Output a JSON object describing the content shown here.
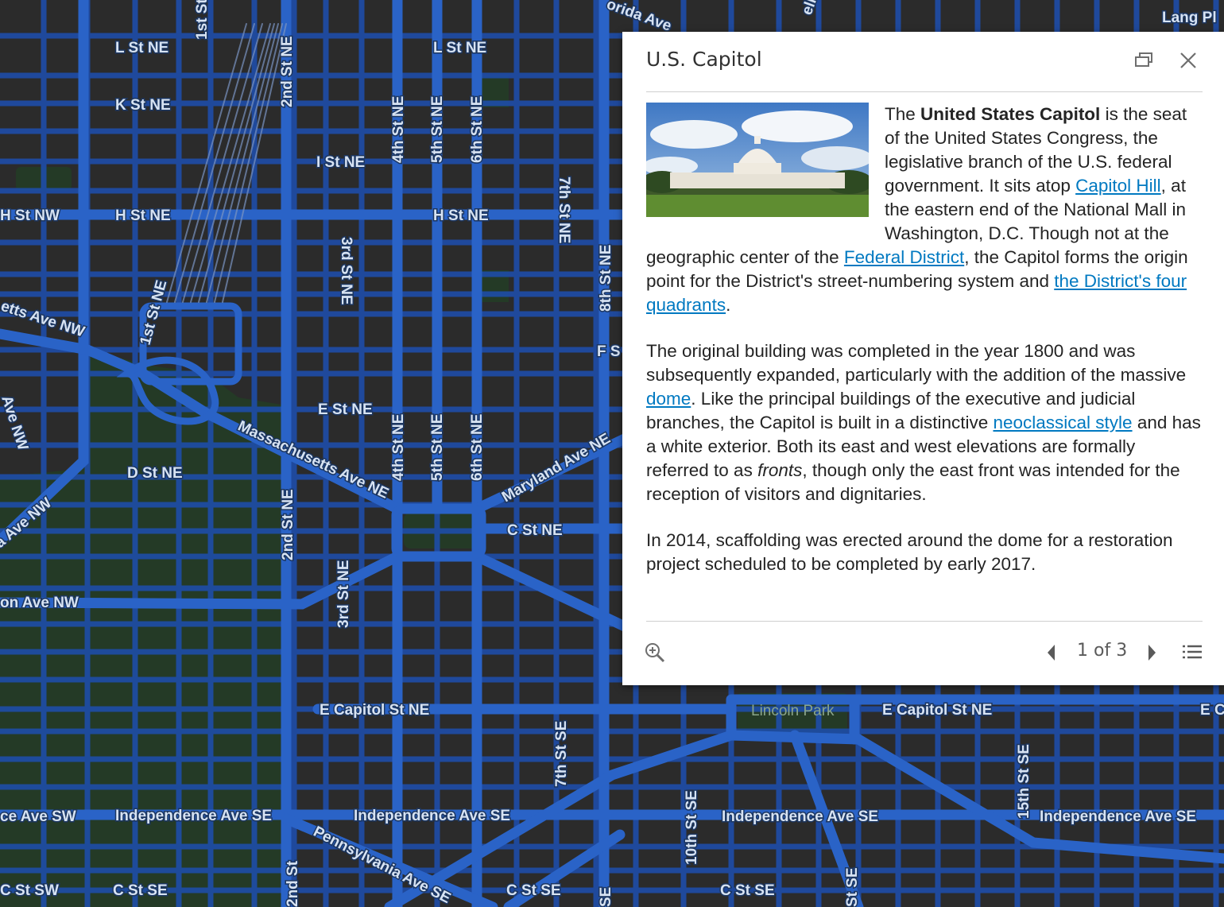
{
  "map": {
    "street_labels": {
      "l_st_1": "L St NE",
      "l_st_2": "L St NE",
      "k_st": "K St NE",
      "i_st": "I St NE",
      "h_st_nw": "H St NW",
      "h_st_1": "H St NE",
      "h_st_2": "H St NE",
      "e_st": "E St NE",
      "d_st": "D St NE",
      "c_st": "C St NE",
      "e_capitol_1": "E Capitol St NE",
      "e_capitol_2": "E Capitol St NE",
      "e_capitol_3": "E C",
      "independence_1": "Independence Ave SE",
      "independence_2": "Independence Ave SE",
      "independence_3": "Independence Ave SE",
      "independence_4": "Independence Ave SE",
      "independence_sw": "ce Ave SW",
      "c_st_sw": "C St SW",
      "c_st_se_1": "C St SE",
      "c_st_se_2": "C St SE",
      "c_st_se_3": "C St SE",
      "first_st_top": "1st St",
      "first_st": "1st St NE",
      "second_st_top": "2nd St NE",
      "second_st_mid": "2nd St NE",
      "second_st_bot": "2nd St",
      "third_st_1": "3rd St NE",
      "third_st_2": "3rd St NE",
      "fourth_st_1": "4th St NE",
      "fourth_st_2": "4th St NE",
      "fifth_st_1": "5th St NE",
      "fifth_st_2": "5th St NE",
      "sixth_st_1": "6th St NE",
      "sixth_st_2": "6th St NE",
      "seventh_st": "7th St NE",
      "seventh_st_se": "7th St SE",
      "eighth_st": "8th St NE",
      "tenth_st_se": "10th St SE",
      "fifteenth_st_se": "15th St SE",
      "st_se_1": "St SE",
      "st_se_2": "SE",
      "f_s": "F S",
      "lang_pl": "Lang Pl",
      "florida": "orida Ave",
      "ello": "ello A",
      "massachusetts": "Massachusetts Ave NE",
      "maryland": "Maryland Ave NE",
      "pennsylvania": "Pennsylvania Ave SE",
      "mass_nw": "etts Ave NW",
      "a_ave_nw": "a Ave NW",
      "on_ave_nw": "on Ave NW",
      "ave_nw": "Ave NW",
      "lincoln_park": "Lincoln Park"
    }
  },
  "popup": {
    "title": "U.S. Capitol",
    "dock_icon": "dock-icon",
    "close_icon": "close-icon",
    "p1_the": "The ",
    "p1_bold": "United States Capitol",
    "p1_text1": " is the seat of the United States Congress, the legislative branch of the U.S. federal government. It sits atop ",
    "p1_link1": "Capitol Hill",
    "p1_text2": ", at the eastern end of the National Mall in Washington, D.C. Though not at the geographic center of the ",
    "p1_link2": "Federal District",
    "p1_text3": ", the Capitol forms the origin point for the District's street-numbering system and ",
    "p1_link3": "the District's four quadrants",
    "p1_text4": ".",
    "p2_text1": "The original building was completed in the year 1800 and was subsequently expanded, particularly with the addition of the massive ",
    "p2_link1": "dome",
    "p2_text2": ". Like the principal buildings of the executive and judicial branches, the Capitol is built in a distinctive ",
    "p2_link2": "neoclassical style",
    "p2_text3": " and has a white exterior. Both its east and west elevations are formally referred to as ",
    "p2_italic": "fronts",
    "p2_text4": ", though only the east front was intended for the reception of visitors and dignitaries.",
    "p3": "In 2014, scaffolding was erected around the dome for a restoration project scheduled to be completed by early 2017.",
    "footer": {
      "zoom_icon": "zoom-to-icon",
      "prev_icon": "previous-icon",
      "pager": "1 of 3",
      "next_icon": "next-icon",
      "list_icon": "feature-list-icon"
    }
  },
  "colors": {
    "road": "#2a63c7",
    "road_glow": "#1d4fb0",
    "background": "#2b2b2b",
    "park": "#243a26",
    "link": "#0079c1"
  }
}
